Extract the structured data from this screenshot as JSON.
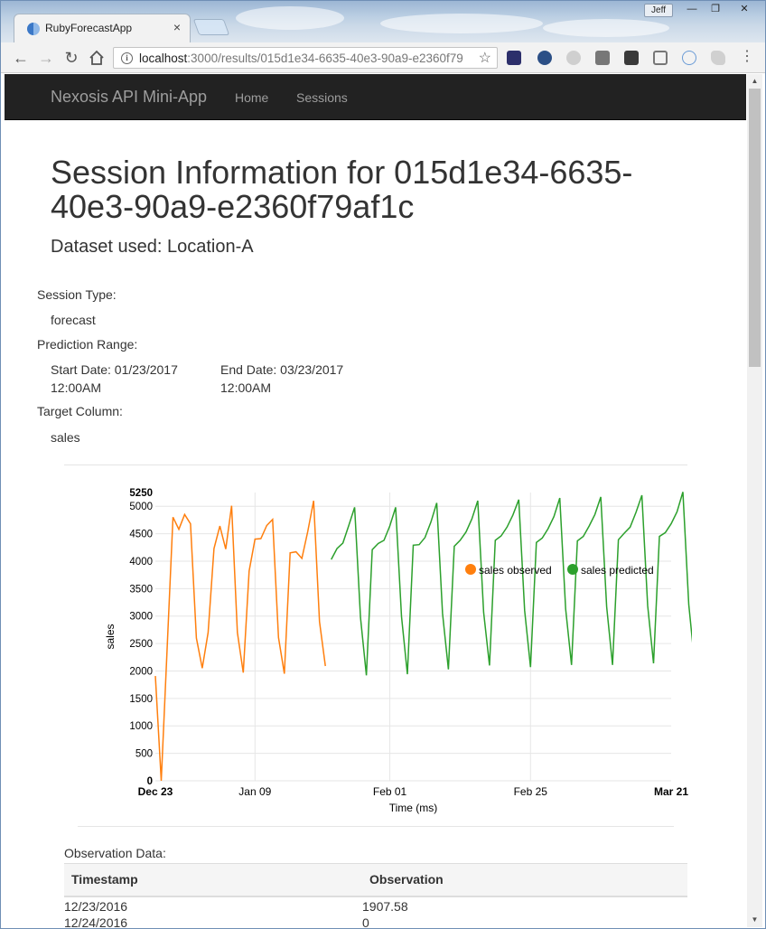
{
  "browser": {
    "tab_title": "RubyForecastApp",
    "tab_close": "×",
    "user_name": "Jeff",
    "url_host": "localhost",
    "url_rest": ":3000/results/015d1e34-6635-40e3-90a9-e2360f79",
    "window_buttons": [
      "—",
      "❐",
      "✕"
    ]
  },
  "navbar": {
    "brand": "Nexosis API Mini-App",
    "links": [
      "Home",
      "Sessions"
    ]
  },
  "session": {
    "title": "Session Information for 015d1e34-6635-40e3-90a9-e2360f79af1c",
    "dataset": "Dataset used: Location-A",
    "type_label": "Session Type:",
    "type_value": "forecast",
    "range_label": "Prediction Range:",
    "start_line1": "Start Date: 01/23/2017",
    "start_line2": "12:00AM",
    "end_line1": "End Date: 03/23/2017",
    "end_line2": "12:00AM",
    "target_label": "Target Column:",
    "target_value": "sales"
  },
  "chart_data": {
    "type": "line",
    "xlabel": "Time (ms)",
    "ylabel": "sales",
    "ylim": [
      0,
      5250
    ],
    "y_ticks": [
      "0",
      "500",
      "1000",
      "1500",
      "2000",
      "2500",
      "3000",
      "3500",
      "4000",
      "4500",
      "5000",
      "5250"
    ],
    "x_ticks": [
      {
        "label": "Dec 23",
        "day": 0,
        "bold": true
      },
      {
        "label": "Jan 09",
        "day": 17,
        "bold": false
      },
      {
        "label": "Feb 01",
        "day": 40,
        "bold": false
      },
      {
        "label": "Feb 25",
        "day": 64,
        "bold": false
      },
      {
        "label": "Mar 21",
        "day": 88,
        "bold": true
      }
    ],
    "legend_position": "top-right",
    "grid": true,
    "series": [
      {
        "name": "sales observed",
        "color": "#ff7f0e",
        "start_day": 0,
        "values": [
          1907.58,
          0,
          2400,
          4800,
          4580,
          4850,
          4680,
          2600,
          2050,
          2700,
          4230,
          4640,
          4220,
          5010,
          2700,
          1970,
          3820,
          4400,
          4410,
          4650,
          4760,
          2610,
          1950,
          4150,
          4170,
          4050,
          4540,
          5100,
          2900,
          2090
        ]
      },
      {
        "name": "sales predicted",
        "color": "#2ca02c",
        "start_day": 30,
        "values": [
          4030,
          4230,
          4330,
          4650,
          4980,
          2970,
          1920,
          4210,
          4320,
          4380,
          4640,
          4980,
          2990,
          1940,
          4290,
          4300,
          4430,
          4710,
          5060,
          3050,
          2030,
          4270,
          4380,
          4530,
          4770,
          5100,
          3070,
          2100,
          4380,
          4460,
          4620,
          4840,
          5120,
          3100,
          2070,
          4340,
          4420,
          4590,
          4810,
          5150,
          3130,
          2110,
          4370,
          4450,
          4640,
          4850,
          5170,
          3170,
          2110,
          4390,
          4510,
          4620,
          4890,
          5200,
          3190,
          2140,
          4450,
          4520,
          4680,
          4900,
          5260,
          3210,
          2140,
          4440,
          4590,
          4680
        ]
      }
    ]
  },
  "observations": {
    "label": "Observation Data:",
    "headers": [
      "Timestamp",
      "Observation"
    ],
    "rows": [
      [
        "12/23/2016",
        "1907.58"
      ],
      [
        "12/24/2016",
        "0"
      ]
    ]
  }
}
